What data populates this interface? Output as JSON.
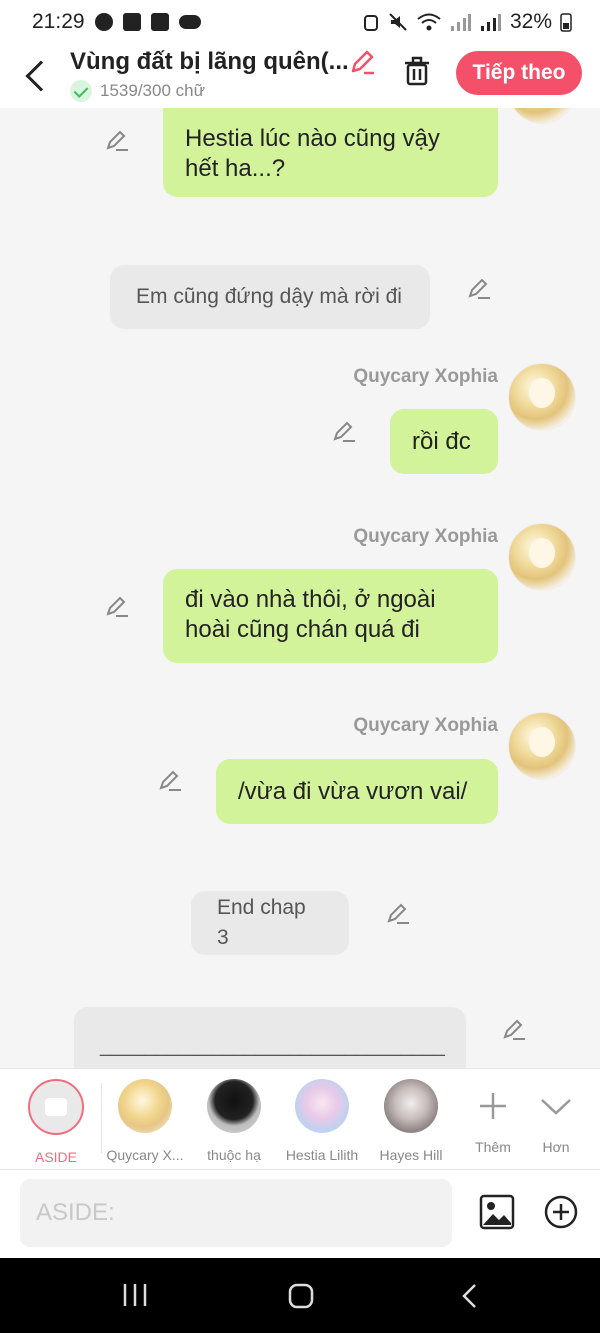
{
  "status": {
    "time": "21:29",
    "battery": "32%"
  },
  "header": {
    "title": "Vùng đất bị lãng quên(...",
    "word_count": "1539/300 chữ",
    "next_label": "Tiếp theo"
  },
  "messages": [
    {
      "type": "right",
      "text_line1": "Hestia lúc nào cũng vậy",
      "text_line2": "hết ha...?"
    },
    {
      "type": "aside",
      "text": "Em cũng đứng dậy mà rời đi"
    },
    {
      "type": "right",
      "name": "Quycary Xophia",
      "text": "rồi đc"
    },
    {
      "type": "right",
      "name": "Quycary Xophia",
      "text_line1": "đi vào nhà thôi, ở ngoài",
      "text_line2": "hoài cũng chán quá đi"
    },
    {
      "type": "right",
      "name": "Quycary Xophia",
      "text": "/vừa đi vừa vươn vai/"
    },
    {
      "type": "aside",
      "text": "End chap 3"
    },
    {
      "type": "aside",
      "text": "_______________________________"
    }
  ],
  "characters": [
    {
      "label": "ASIDE"
    },
    {
      "label": "Quycary X..."
    },
    {
      "label": "thuộc hạ"
    },
    {
      "label": "Hestia Lilith"
    },
    {
      "label": "Hayes Hill"
    },
    {
      "label": "Thêm"
    },
    {
      "label": "Hơn"
    }
  ],
  "input": {
    "placeholder": "ASIDE:"
  },
  "colors": {
    "accent": "#f4506a",
    "bubble_green": "#d3f39a",
    "bubble_gray": "#e9e9e9"
  }
}
